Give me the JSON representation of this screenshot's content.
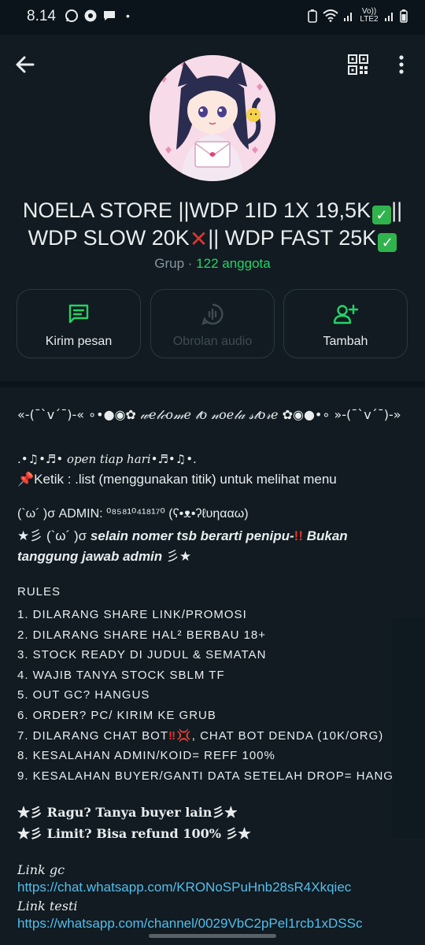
{
  "status_bar": {
    "time": "8.14",
    "dot": "•",
    "network_label": "Vo)) LTE2"
  },
  "group": {
    "name_line1_a": "NOELA STORE ||WDP 1ID 1X 19,5K",
    "name_line1_b": "||",
    "name_line2_a": "WDP SLOW 20K",
    "name_line2_b": "|| WDP FAST 25K",
    "check_glyph": "✓",
    "cross_glyph": "✕",
    "type": "Grup",
    "separator": " · ",
    "members": "122 anggota"
  },
  "actions": [
    {
      "label": "Kirim pesan",
      "icon": "message-icon",
      "enabled": true
    },
    {
      "label": "Obrolan audio",
      "icon": "audio-chat-icon",
      "enabled": false
    },
    {
      "label": "Tambah",
      "icon": "add-person-icon",
      "enabled": true
    }
  ],
  "description": {
    "welcome_left": "«-(¯`v´¯)-« ∘•●◉✿ ",
    "welcome_mid": "𝓌𝑒𝓁𝒸𝑜𝓂𝑒 𝓉𝑜 𝓃𝑜𝑒𝓁𝒶 𝓈𝓉𝑜𝓇𝑒",
    "welcome_right": " ✿◉●•∘ »-(¯`v´¯)-»",
    "open_line": ".•♫•♬• open tiap hari•♬•♫•.",
    "ketik_pin": "📌",
    "ketik_line": "Ketik : .list (menggunakan titik) untuk melihat menu",
    "admin_line": "(`ω´ )σ ADMIN: ⁰⁸⁵⁸¹⁰⁴¹⁸¹⁷⁰ (ʕ•ᴥ•ʔℓυηααω)",
    "warn_prefix": "★彡 (`ω´ )σ ",
    "warn_text_a": "selain nomer tsb berarti penipu-",
    "warn_excl": "!!",
    "warn_text_b": " Bukan tanggung jawab admin ",
    "warn_suffix": "彡★",
    "rules_title": "RULES",
    "rules": [
      "1. DILARANG SHARE LINK/PROMOSI",
      "2. DILARANG SHARE HAL² BERBAU 18+",
      "3. STOCK READY DI JUDUL & SEMATAN",
      "4. WAJIB TANYA STOCK SBLM TF",
      "5. OUT GC? HANGUS",
      "6. ORDER? PC/ KIRIM KE GRUB",
      "7. DILARANG CHAT BOT",
      "8. KESALAHAN ADMIN/KOID= REFF 100%",
      "9. KESALAHAN BUYER/GANTI DATA SETELAH DROP= HANGUS"
    ],
    "rule7_tail": ", CHAT BOT DENDA (10K/ORG)",
    "rule7_marks": "‼💢",
    "ragu_line": "★彡 Ragu? Tanya buyer lain彡★",
    "limit_line": "★彡 Limit?  Bisa refund 100% 彡★",
    "link_gc_label": "Link gc",
    "link_gc": "https://chat.whatsapp.com/KRONoSPuHnb28sR4Xkqiec",
    "link_testi_label": "Link testi",
    "link_testi": "https://whatsapp.com/channel/0029VbC2pPel1rcb1xDSSc"
  },
  "colors": {
    "background": "#0b141a",
    "panel": "#111b21",
    "accent_green": "#25d366",
    "link_blue": "#53bdeb"
  }
}
